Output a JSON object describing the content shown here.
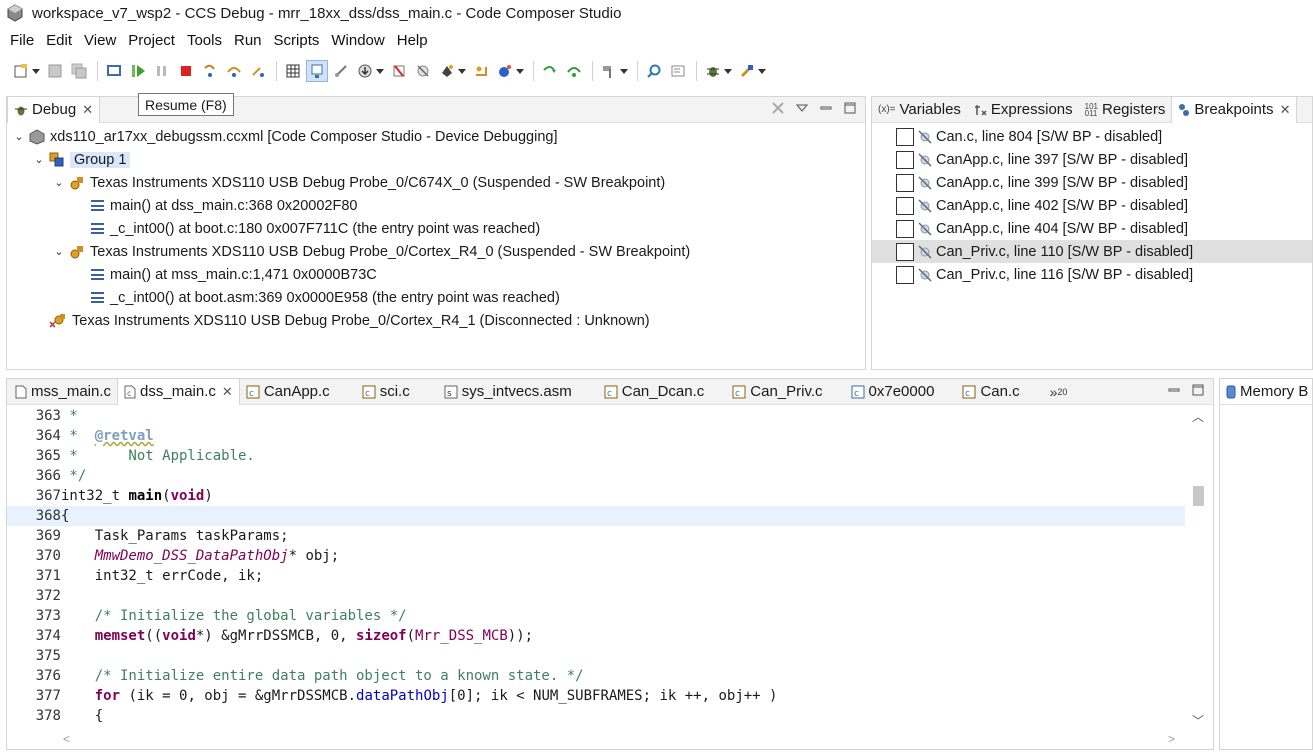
{
  "window": {
    "title": "workspace_v7_wsp2 - CCS Debug - mrr_18xx_dss/dss_main.c - Code Composer Studio"
  },
  "menu": [
    "File",
    "Edit",
    "View",
    "Project",
    "Tools",
    "Run",
    "Scripts",
    "Window",
    "Help"
  ],
  "tooltip": "Resume (F8)",
  "debug": {
    "tab_label": "Debug",
    "tree": [
      {
        "label": "xds110_ar17xx_debugssm.ccxml [Code Composer Studio - Device Debugging]"
      },
      {
        "label": "Group 1"
      },
      {
        "label": "Texas Instruments XDS110 USB Debug Probe_0/C674X_0 (Suspended - SW Breakpoint)"
      },
      {
        "label": "main() at dss_main.c:368 0x20002F80"
      },
      {
        "label": "_c_int00() at boot.c:180 0x007F711C  (the entry point was reached)"
      },
      {
        "label": "Texas Instruments XDS110 USB Debug Probe_0/Cortex_R4_0 (Suspended - SW Breakpoint)"
      },
      {
        "label": "main() at mss_main.c:1,471 0x0000B73C"
      },
      {
        "label": "_c_int00() at boot.asm:369 0x0000E958  (the entry point was reached)"
      },
      {
        "label": "Texas Instruments XDS110 USB Debug Probe_0/Cortex_R4_1 (Disconnected : Unknown)"
      }
    ]
  },
  "right_tabs": {
    "variables": "Variables",
    "expressions": "Expressions",
    "registers": "Registers",
    "breakpoints": "Breakpoints"
  },
  "breakpoints": [
    "Can.c, line 804 [S/W BP - disabled]",
    "CanApp.c, line 397 [S/W BP - disabled]",
    "CanApp.c, line 399 [S/W BP - disabled]",
    "CanApp.c, line 402 [S/W BP - disabled]",
    "CanApp.c, line 404 [S/W BP - disabled]",
    "Can_Priv.c, line 110 [S/W BP - disabled]",
    "Can_Priv.c, line 116 [S/W BP - disabled]"
  ],
  "editor": {
    "tabs": [
      "mss_main.c",
      "dss_main.c",
      "CanApp.c",
      "sci.c",
      "sys_intvecs.asm",
      "Can_Dcan.c",
      "Can_Priv.c",
      "0x7e0000",
      "Can.c"
    ],
    "overflow": "»",
    "overflow_count": "20",
    "lines": {
      "n363": "363",
      "t363": " *",
      "n364": "364",
      "t364a": " *  ",
      "t364b": "@retval",
      "n365": "365",
      "t365": " *      Not Applicable.",
      "n366": "366",
      "t366": " */",
      "n367": "367",
      "t367a": "int32_t ",
      "t367b": "main",
      "t367c": "(",
      "t367d": "void",
      "t367e": ")",
      "n368": "368",
      "t368": "{",
      "n369": "369",
      "t369": "    Task_Params taskParams;",
      "n370": "370",
      "t370a": "    ",
      "t370b": "MmwDemo_DSS_DataPathObj",
      "t370c": "* obj;",
      "n371": "371",
      "t371": "    int32_t errCode, ik;",
      "n372": "372",
      "n373": "373",
      "t373": "    /* Initialize the global variables */",
      "n374": "374",
      "t374a": "    ",
      "t374b": "memset",
      "t374c": "((",
      "t374d": "void",
      "t374e": "*) &gMrrDSSMCB, 0, ",
      "t374f": "sizeof",
      "t374g": "(",
      "t374h": "Mrr_DSS_MCB",
      "t374i": "));",
      "n375": "375",
      "n376": "376",
      "t376": "    /* Initialize entire data path object to a known state. */",
      "n377": "377",
      "t377a": "    ",
      "t377b": "for",
      "t377c": " (ik = 0, obj = &gMrrDSSMCB.",
      "t377d": "dataPathObj",
      "t377e": "[0]; ik < NUM_SUBFRAMES; ik ++, obj++ )",
      "n378": "378",
      "t378": "    {"
    }
  },
  "memory": {
    "tab_label": "Memory B"
  }
}
